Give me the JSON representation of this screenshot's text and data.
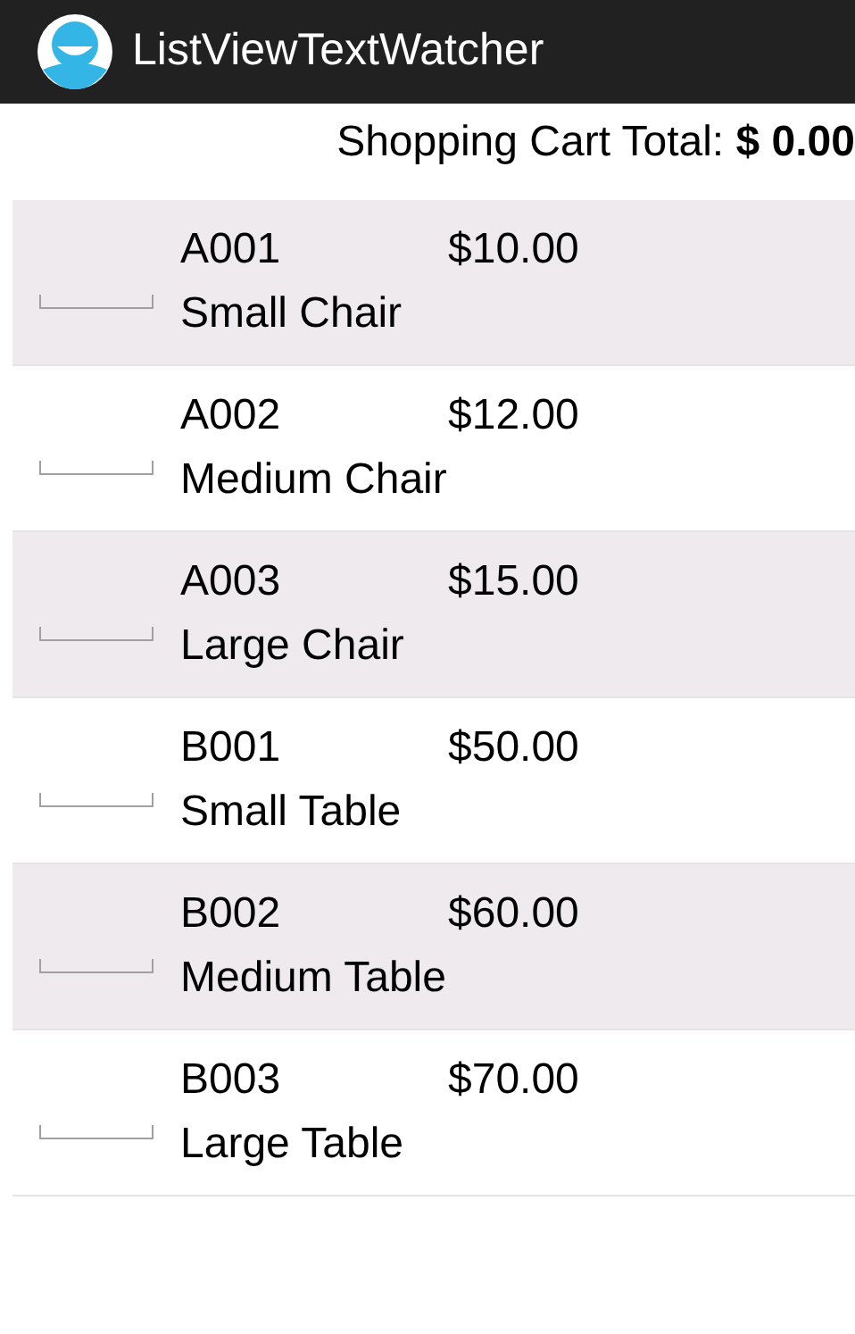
{
  "action_bar": {
    "title": "ListViewTextWatcher"
  },
  "cart_total": "Shopping Cart Total: **$ 0.00**",
  "products": [
    {
      "code": "A001",
      "price": "$10.00",
      "name": "Small Chair"
    },
    {
      "code": "A002",
      "price": "$12.00",
      "name": "Medium Chair"
    },
    {
      "code": "A003",
      "price": "$15.00",
      "name": "Large Chair"
    },
    {
      "code": "B001",
      "price": "$50.00",
      "name": "Small Table"
    },
    {
      "code": "B002",
      "price": "$60.00",
      "name": "Medium Table"
    },
    {
      "code": "B003",
      "price": "$70.00",
      "name": "Large Table"
    }
  ]
}
